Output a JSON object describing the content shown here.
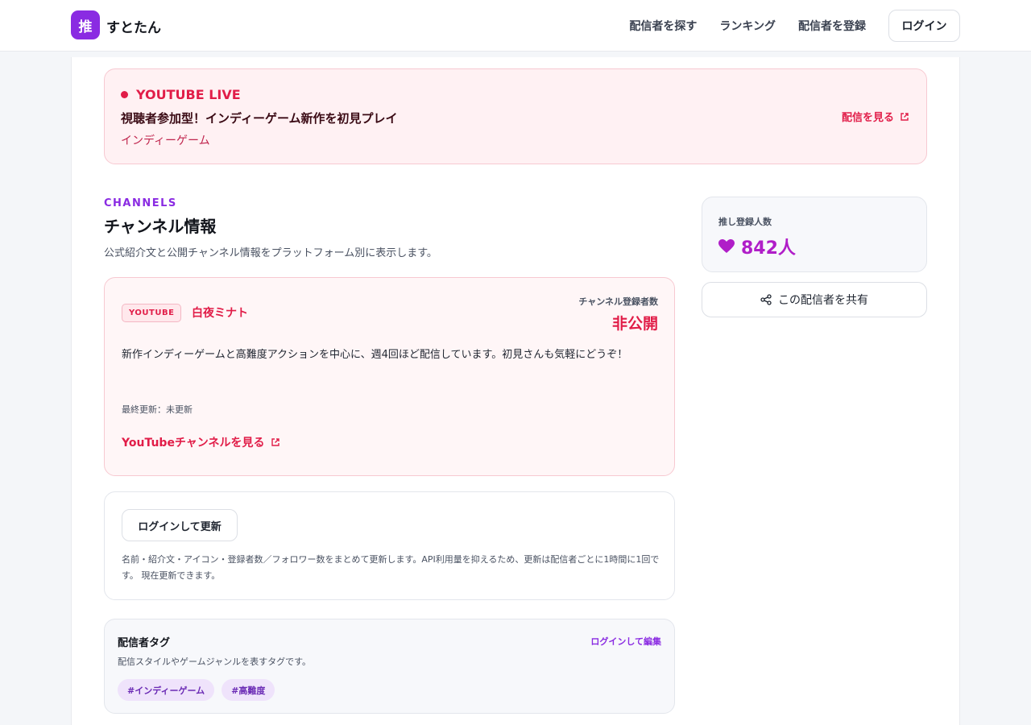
{
  "header": {
    "logo_char": "推",
    "brand": "すとたん",
    "nav": [
      "配信者を探す",
      "ランキング",
      "配信者を登録"
    ],
    "login_label": "ログイン"
  },
  "live": {
    "label": "YOUTUBE LIVE",
    "title": "視聴者参加型！インディーゲーム新作を初見プレイ",
    "genre": "インディーゲーム",
    "watch_label": "配信を見る"
  },
  "channels": {
    "eyebrow": "CHANNELS",
    "title": "チャンネル情報",
    "description": "公式紹介文と公開チャンネル情報をプラットフォーム別に表示します。"
  },
  "youtube_card": {
    "platform": "YOUTUBE",
    "name": "白夜ミナト",
    "subs_label": "チャンネル登録者数",
    "subs_value": "非公開",
    "description": "新作インディーゲームと高難度アクションを中心に、週4回ほど配信しています。初見さんも気軽にどうぞ！",
    "updated": "最終更新：未更新",
    "link_label": "YouTubeチャンネルを見る"
  },
  "update_card": {
    "button_label": "ログインして更新",
    "note": "名前・紹介文・アイコン・登録者数／フォロワー数をまとめて更新します。API利用量を抑えるため、更新は配信者ごとに1時間に1回です。 現在更新できます。"
  },
  "tags_card": {
    "title": "配信者タグ",
    "edit_label": "ログインして編集",
    "description": "配信スタイルやゲームジャンルを表すタグです。",
    "tags": [
      "#インディーゲーム",
      "#高難度"
    ]
  },
  "sidebar": {
    "fan_label": "推し登録人数",
    "fan_count": "842人",
    "share_label": "この配信者を共有"
  },
  "colors": {
    "brand_purple": "#8a2be2",
    "youtube_red": "#e11d48",
    "fan_magenta": "#b01ec8"
  },
  "icons": {
    "logo": "logo-badge",
    "live": "live-dot-icon",
    "external": "external-link-icon",
    "heart": "heart-icon",
    "share": "share-icon"
  }
}
